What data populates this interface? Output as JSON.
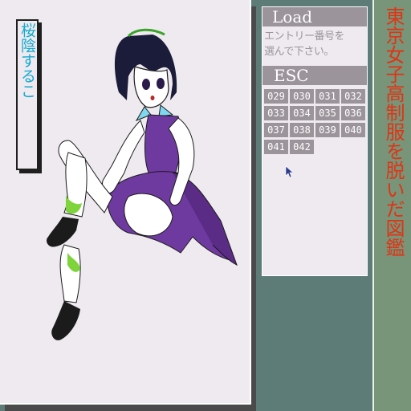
{
  "character_name": "桜陰するこ",
  "load_panel": {
    "title": "Load",
    "prompt_line1": "エントリー番号を",
    "prompt_line2": "選んで下さい。",
    "esc_label": "ESC",
    "slots": [
      "029",
      "030",
      "031",
      "032",
      "033",
      "034",
      "035",
      "036",
      "037",
      "038",
      "039",
      "040",
      "041",
      "042"
    ]
  },
  "game_title": "東京女子高制服を脱いだ図鑑",
  "colors": {
    "panel_bg": "#eeeaf0",
    "button_gray": "#9b949b",
    "name_cyan": "#14aad0",
    "title_red": "#e03414",
    "side_green": "#78957a",
    "backdrop": "#5d7b77"
  },
  "icons": [
    "mouse-pointer-icon"
  ]
}
